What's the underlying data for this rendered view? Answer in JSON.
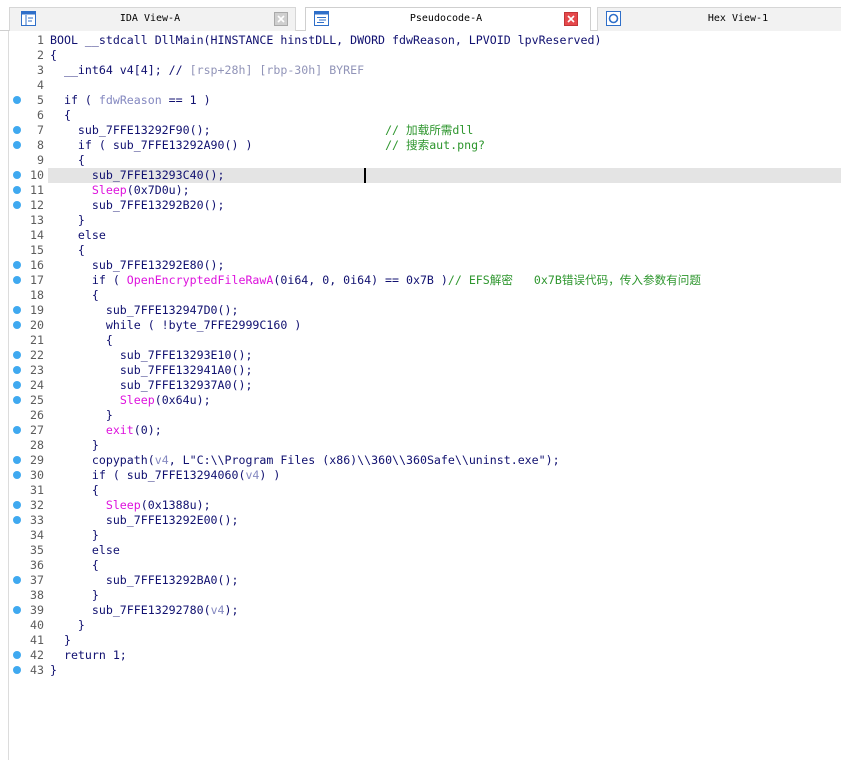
{
  "tabs": [
    {
      "label": "IDA View-A",
      "icon": "disassembly-view-icon",
      "close_icon": "close-icon",
      "active": false
    },
    {
      "label": "Pseudocode-A",
      "icon": "pseudocode-view-icon",
      "close_icon": "close-icon",
      "active": true
    },
    {
      "label": "Hex View-1",
      "icon": "hex-view-icon",
      "active": false
    }
  ],
  "colors": {
    "plain": "#101070",
    "variable": "#8488c0",
    "import": "#dd11dd",
    "comment": "#2e962e",
    "autocomment": "#9194b8",
    "line_number": "#5c5c5c",
    "marker": "#3fa9f0",
    "highlight": "#e4e4e4",
    "close_active": "#e5484b"
  },
  "editor": {
    "marker_icon": "address-dot-icon",
    "current_line": 10,
    "lines": [
      {
        "n": 1,
        "marker": false,
        "tokens": [
          [
            "BOOL __stdcall DllMain(HINSTANCE hinstDLL, DWORD fdwReason, LPVOID lpvReserved)",
            "p"
          ]
        ]
      },
      {
        "n": 2,
        "marker": false,
        "tokens": [
          [
            "{",
            "p"
          ]
        ]
      },
      {
        "n": 3,
        "marker": false,
        "tokens": [
          [
            "  __int64 v4[4]; //",
            "p"
          ],
          [
            " [rsp+28h] [rbp-30h] BYREF",
            "a"
          ]
        ]
      },
      {
        "n": 4,
        "marker": false,
        "tokens": []
      },
      {
        "n": 5,
        "marker": true,
        "tokens": [
          [
            "  if ( ",
            "p"
          ],
          [
            "fdwReason",
            "v"
          ],
          [
            " == 1 )",
            "p"
          ]
        ]
      },
      {
        "n": 6,
        "marker": false,
        "tokens": [
          [
            "  {",
            "p"
          ]
        ]
      },
      {
        "n": 7,
        "marker": true,
        "tokens": [
          [
            "    ",
            "p"
          ],
          [
            "sub_7FFE13292F90",
            "n"
          ],
          [
            "();                         ",
            "p"
          ],
          [
            "// 加载所需dll",
            "c"
          ]
        ]
      },
      {
        "n": 8,
        "marker": true,
        "tokens": [
          [
            "    if ( ",
            "p"
          ],
          [
            "sub_7FFE13292A90",
            "n"
          ],
          [
            "() )                   ",
            "p"
          ],
          [
            "// 搜索aut.png?",
            "c"
          ]
        ]
      },
      {
        "n": 9,
        "marker": false,
        "tokens": [
          [
            "    {",
            "p"
          ]
        ]
      },
      {
        "n": 10,
        "marker": true,
        "tokens": [
          [
            "      ",
            "p"
          ],
          [
            "sub_7FFE13293C40",
            "n"
          ],
          [
            "();",
            "p"
          ]
        ]
      },
      {
        "n": 11,
        "marker": true,
        "tokens": [
          [
            "      ",
            "p"
          ],
          [
            "Sleep",
            "i"
          ],
          [
            "(0x7D0u);",
            "p"
          ]
        ]
      },
      {
        "n": 12,
        "marker": true,
        "tokens": [
          [
            "      ",
            "p"
          ],
          [
            "sub_7FFE13292B20",
            "n"
          ],
          [
            "();",
            "p"
          ]
        ]
      },
      {
        "n": 13,
        "marker": false,
        "tokens": [
          [
            "    }",
            "p"
          ]
        ]
      },
      {
        "n": 14,
        "marker": false,
        "tokens": [
          [
            "    else",
            "p"
          ]
        ]
      },
      {
        "n": 15,
        "marker": false,
        "tokens": [
          [
            "    {",
            "p"
          ]
        ]
      },
      {
        "n": 16,
        "marker": true,
        "tokens": [
          [
            "      ",
            "p"
          ],
          [
            "sub_7FFE13292E80",
            "n"
          ],
          [
            "();",
            "p"
          ]
        ]
      },
      {
        "n": 17,
        "marker": true,
        "tokens": [
          [
            "      if ( ",
            "p"
          ],
          [
            "OpenEncryptedFileRawA",
            "i"
          ],
          [
            "(0i64, 0, 0i64) == 0x7B )",
            "p"
          ],
          [
            "// EFS解密   0x7B错误代码，传入参数有问题",
            "c"
          ]
        ]
      },
      {
        "n": 18,
        "marker": false,
        "tokens": [
          [
            "      {",
            "p"
          ]
        ]
      },
      {
        "n": 19,
        "marker": true,
        "tokens": [
          [
            "        ",
            "p"
          ],
          [
            "sub_7FFE132947D0",
            "n"
          ],
          [
            "();",
            "p"
          ]
        ]
      },
      {
        "n": 20,
        "marker": true,
        "tokens": [
          [
            "        while ( !",
            "p"
          ],
          [
            "byte_7FFE2999C160",
            "n"
          ],
          [
            " )",
            "p"
          ]
        ]
      },
      {
        "n": 21,
        "marker": false,
        "tokens": [
          [
            "        {",
            "p"
          ]
        ]
      },
      {
        "n": 22,
        "marker": true,
        "tokens": [
          [
            "          ",
            "p"
          ],
          [
            "sub_7FFE13293E10",
            "n"
          ],
          [
            "();",
            "p"
          ]
        ]
      },
      {
        "n": 23,
        "marker": true,
        "tokens": [
          [
            "          ",
            "p"
          ],
          [
            "sub_7FFE132941A0",
            "n"
          ],
          [
            "();",
            "p"
          ]
        ]
      },
      {
        "n": 24,
        "marker": true,
        "tokens": [
          [
            "          ",
            "p"
          ],
          [
            "sub_7FFE132937A0",
            "n"
          ],
          [
            "();",
            "p"
          ]
        ]
      },
      {
        "n": 25,
        "marker": true,
        "tokens": [
          [
            "          ",
            "p"
          ],
          [
            "Sleep",
            "i"
          ],
          [
            "(0x64u);",
            "p"
          ]
        ]
      },
      {
        "n": 26,
        "marker": false,
        "tokens": [
          [
            "        }",
            "p"
          ]
        ]
      },
      {
        "n": 27,
        "marker": true,
        "tokens": [
          [
            "        ",
            "p"
          ],
          [
            "exit",
            "i"
          ],
          [
            "(0);",
            "p"
          ]
        ]
      },
      {
        "n": 28,
        "marker": false,
        "tokens": [
          [
            "      }",
            "p"
          ]
        ]
      },
      {
        "n": 29,
        "marker": true,
        "tokens": [
          [
            "      ",
            "p"
          ],
          [
            "copypath",
            "n"
          ],
          [
            "(",
            "p"
          ],
          [
            "v4",
            "v"
          ],
          [
            ", L\"C:\\\\Program Files (x86)\\\\360\\\\360Safe\\\\uninst.exe\");",
            "p"
          ]
        ]
      },
      {
        "n": 30,
        "marker": true,
        "tokens": [
          [
            "      if ( ",
            "p"
          ],
          [
            "sub_7FFE13294060",
            "n"
          ],
          [
            "(",
            "p"
          ],
          [
            "v4",
            "v"
          ],
          [
            ") )",
            "p"
          ]
        ]
      },
      {
        "n": 31,
        "marker": false,
        "tokens": [
          [
            "      {",
            "p"
          ]
        ]
      },
      {
        "n": 32,
        "marker": true,
        "tokens": [
          [
            "        ",
            "p"
          ],
          [
            "Sleep",
            "i"
          ],
          [
            "(0x1388u);",
            "p"
          ]
        ]
      },
      {
        "n": 33,
        "marker": true,
        "tokens": [
          [
            "        ",
            "p"
          ],
          [
            "sub_7FFE13292E00",
            "n"
          ],
          [
            "();",
            "p"
          ]
        ]
      },
      {
        "n": 34,
        "marker": false,
        "tokens": [
          [
            "      }",
            "p"
          ]
        ]
      },
      {
        "n": 35,
        "marker": false,
        "tokens": [
          [
            "      else",
            "p"
          ]
        ]
      },
      {
        "n": 36,
        "marker": false,
        "tokens": [
          [
            "      {",
            "p"
          ]
        ]
      },
      {
        "n": 37,
        "marker": true,
        "tokens": [
          [
            "        ",
            "p"
          ],
          [
            "sub_7FFE13292BA0",
            "n"
          ],
          [
            "();",
            "p"
          ]
        ]
      },
      {
        "n": 38,
        "marker": false,
        "tokens": [
          [
            "      }",
            "p"
          ]
        ]
      },
      {
        "n": 39,
        "marker": true,
        "tokens": [
          [
            "      ",
            "p"
          ],
          [
            "sub_7FFE13292780",
            "n"
          ],
          [
            "(",
            "p"
          ],
          [
            "v4",
            "v"
          ],
          [
            ");",
            "p"
          ]
        ]
      },
      {
        "n": 40,
        "marker": false,
        "tokens": [
          [
            "    }",
            "p"
          ]
        ]
      },
      {
        "n": 41,
        "marker": false,
        "tokens": [
          [
            "  }",
            "p"
          ]
        ]
      },
      {
        "n": 42,
        "marker": true,
        "tokens": [
          [
            "  return 1;",
            "p"
          ]
        ]
      },
      {
        "n": 43,
        "marker": true,
        "tokens": [
          [
            "}",
            "p"
          ]
        ]
      }
    ]
  }
}
